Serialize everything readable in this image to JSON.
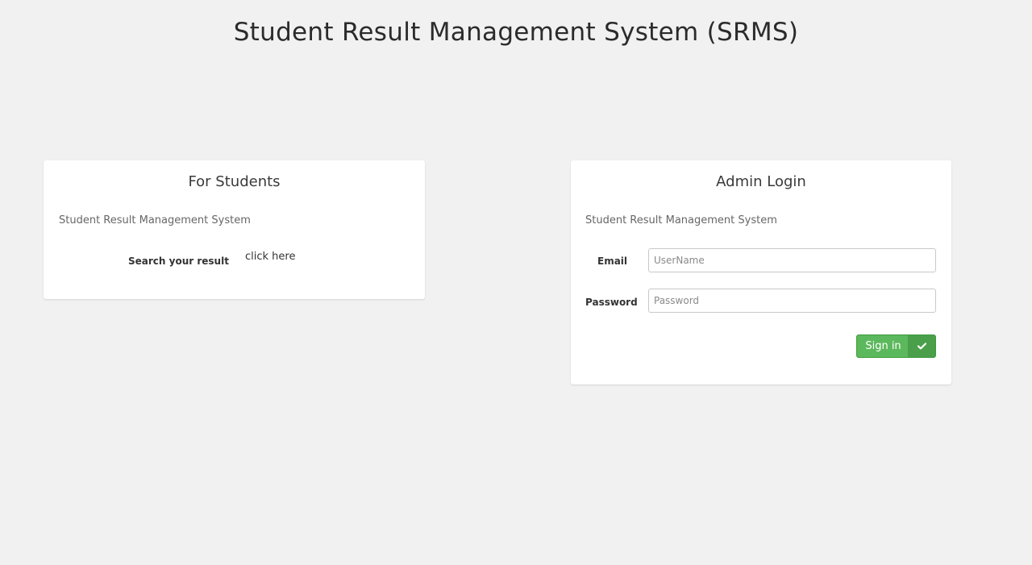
{
  "page": {
    "title": "Student Result Management System (SRMS)"
  },
  "students_panel": {
    "heading": "For Students",
    "subtitle": "Student Result Management System",
    "search_label": "Search your result",
    "link_text": "click here"
  },
  "admin_panel": {
    "heading": "Admin Login",
    "subtitle": "Student Result Management System",
    "email_label": "Email",
    "email_placeholder": "UserName",
    "email_value": "",
    "password_label": "Password",
    "password_placeholder": "Password",
    "password_value": "",
    "signin_label": "Sign in",
    "signin_icon": "check-icon"
  },
  "colors": {
    "background": "#f1f1f1",
    "panel": "#ffffff",
    "button_primary": "#5cb85c",
    "button_icon_bg": "#4a9f4a"
  }
}
